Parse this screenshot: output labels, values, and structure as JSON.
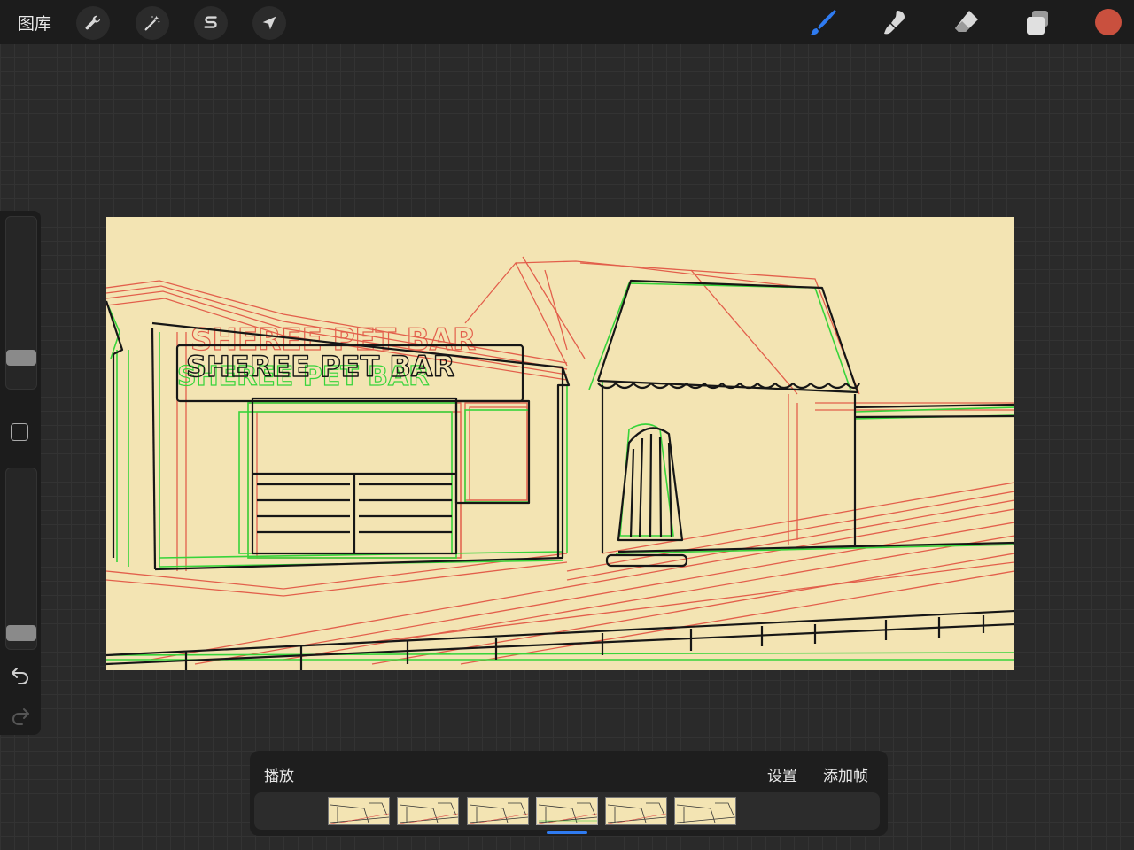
{
  "topbar": {
    "gallery_label": "图库",
    "left_tools": [
      "wrench-icon",
      "magic-wand-icon",
      "selection-s-icon",
      "transform-arrow-icon"
    ],
    "right_tools": [
      "brush-icon",
      "smudge-icon",
      "eraser-icon",
      "layers-icon"
    ],
    "active_tool": "brush-icon",
    "accent_color": "#2f7bf0",
    "current_color": "#c9503e"
  },
  "sidebar": {
    "brush_size_level": 0.15,
    "opacity_level": 0.05
  },
  "canvas": {
    "background": "#f3e4b3",
    "sign_text": "SHEREE PET BAR"
  },
  "timeline": {
    "play_label": "播放",
    "settings_label": "设置",
    "add_frame_label": "添加帧",
    "frame_count": 6,
    "selected_frame": 4
  }
}
